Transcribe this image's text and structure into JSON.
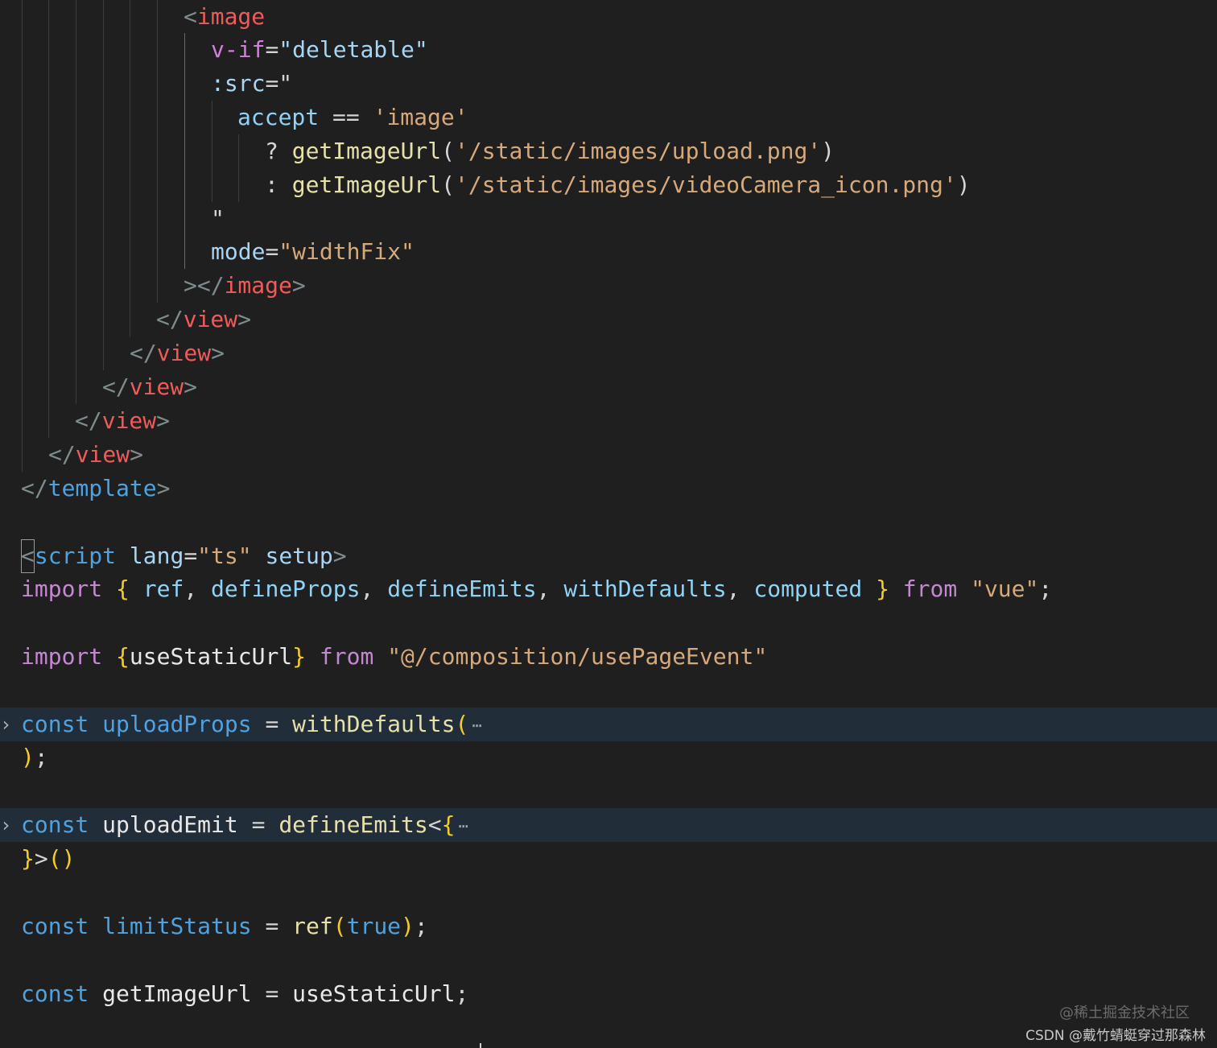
{
  "editor": {
    "lines": [
      {
        "tokens": [
          [
            "<",
            "punct"
          ],
          [
            "image",
            "tag"
          ]
        ]
      },
      {
        "tokens": [
          [
            "v-if",
            "attr-pink"
          ],
          [
            "=",
            "plain"
          ],
          [
            "\"deletable\"",
            "attr"
          ]
        ]
      },
      {
        "tokens": [
          [
            ":src",
            "attr"
          ],
          [
            "=\"",
            "plain"
          ]
        ]
      },
      {
        "tokens": [
          [
            "accept",
            "var"
          ],
          [
            " == ",
            "plain"
          ],
          [
            "'image'",
            "str"
          ]
        ]
      },
      {
        "tokens": [
          [
            "? ",
            "plain"
          ],
          [
            "getImageUrl",
            "fn"
          ],
          [
            "(",
            "plain"
          ],
          [
            "'/static/images/upload.png'",
            "str"
          ],
          [
            ")",
            "plain"
          ]
        ]
      },
      {
        "tokens": [
          [
            ": ",
            "plain"
          ],
          [
            "getImageUrl",
            "fn"
          ],
          [
            "(",
            "plain"
          ],
          [
            "'/static/images/videoCamera_icon.png'",
            "str"
          ],
          [
            ")",
            "plain"
          ]
        ]
      },
      {
        "tokens": [
          [
            "\"",
            "plain"
          ]
        ]
      },
      {
        "tokens": [
          [
            "mode",
            "attr"
          ],
          [
            "=",
            "plain"
          ],
          [
            "\"widthFix\"",
            "str"
          ]
        ]
      },
      {
        "tokens": [
          [
            "></",
            "punct"
          ],
          [
            "image",
            "tag"
          ],
          [
            ">",
            "punct"
          ]
        ]
      },
      {
        "tokens": [
          [
            "</",
            "punct"
          ],
          [
            "view",
            "tag"
          ],
          [
            ">",
            "punct"
          ]
        ]
      },
      {
        "tokens": [
          [
            "</",
            "punct"
          ],
          [
            "view",
            "tag"
          ],
          [
            ">",
            "punct"
          ]
        ]
      },
      {
        "tokens": [
          [
            "</",
            "punct"
          ],
          [
            "view",
            "tag"
          ],
          [
            ">",
            "punct"
          ]
        ]
      },
      {
        "tokens": [
          [
            "</",
            "punct"
          ],
          [
            "view",
            "tag"
          ],
          [
            ">",
            "punct"
          ]
        ]
      },
      {
        "tokens": [
          [
            "</",
            "punct"
          ],
          [
            "view",
            "tag"
          ],
          [
            ">",
            "punct"
          ]
        ]
      },
      {
        "tokens": [
          [
            "</",
            "punct"
          ],
          [
            "template",
            "tag-blue"
          ],
          [
            ">",
            "punct"
          ]
        ]
      },
      {
        "tokens": []
      },
      {
        "tokens": [
          [
            "<",
            "cursor"
          ],
          [
            "script",
            "tag-blue"
          ],
          [
            " ",
            "plain"
          ],
          [
            "lang",
            "attr"
          ],
          [
            "=",
            "plain"
          ],
          [
            "\"ts\"",
            "str"
          ],
          [
            " ",
            "plain"
          ],
          [
            "setup",
            "attr"
          ],
          [
            ">",
            "punct"
          ]
        ]
      },
      {
        "tokens": [
          [
            "import",
            "kw"
          ],
          [
            " ",
            "plain"
          ],
          [
            "{",
            "brace"
          ],
          [
            " ",
            "plain"
          ],
          [
            "ref",
            "var"
          ],
          [
            ", ",
            "plain"
          ],
          [
            "defineProps",
            "var"
          ],
          [
            ", ",
            "plain"
          ],
          [
            "defineEmits",
            "var"
          ],
          [
            ", ",
            "plain"
          ],
          [
            "withDefaults",
            "var"
          ],
          [
            ", ",
            "plain"
          ],
          [
            "computed",
            "var"
          ],
          [
            " ",
            "plain"
          ],
          [
            "}",
            "brace"
          ],
          [
            " ",
            "plain"
          ],
          [
            "from",
            "kw"
          ],
          [
            " ",
            "plain"
          ],
          [
            "\"vue\"",
            "str"
          ],
          [
            ";",
            "plain"
          ]
        ]
      },
      {
        "tokens": []
      },
      {
        "tokens": [
          [
            "import",
            "kw"
          ],
          [
            " ",
            "plain"
          ],
          [
            "{",
            "brace"
          ],
          [
            "useStaticUrl",
            "var2"
          ],
          [
            "}",
            "brace"
          ],
          [
            " ",
            "plain"
          ],
          [
            "from",
            "kw"
          ],
          [
            " ",
            "plain"
          ],
          [
            "\"@/composition/usePageEvent\"",
            "str"
          ]
        ]
      },
      {
        "tokens": []
      },
      {
        "tokens": [
          [
            "const",
            "const"
          ],
          [
            " ",
            "plain"
          ],
          [
            "uploadProps",
            "const"
          ],
          [
            " = ",
            "plain"
          ],
          [
            "withDefaults",
            "fn"
          ],
          [
            "(",
            "brace"
          ]
        ],
        "folded": true
      },
      {
        "tokens": [
          [
            ")",
            "brace"
          ],
          [
            ";",
            "plain"
          ]
        ]
      },
      {
        "tokens": []
      },
      {
        "tokens": [
          [
            "const",
            "const"
          ],
          [
            " ",
            "plain"
          ],
          [
            "uploadEmit",
            "var2"
          ],
          [
            " = ",
            "plain"
          ],
          [
            "defineEmits",
            "fn"
          ],
          [
            "<",
            "plain"
          ],
          [
            "{",
            "brace"
          ]
        ],
        "folded": true
      },
      {
        "tokens": [
          [
            "}",
            "brace"
          ],
          [
            ">",
            "plain"
          ],
          [
            "()",
            "brace"
          ]
        ]
      },
      {
        "tokens": []
      },
      {
        "tokens": [
          [
            "const",
            "const"
          ],
          [
            " ",
            "plain"
          ],
          [
            "limitStatus",
            "const"
          ],
          [
            " = ",
            "plain"
          ],
          [
            "ref",
            "fn"
          ],
          [
            "(",
            "brace"
          ],
          [
            "true",
            "bool"
          ],
          [
            ")",
            "brace"
          ],
          [
            ";",
            "plain"
          ]
        ]
      },
      {
        "tokens": []
      },
      {
        "tokens": [
          [
            "const",
            "const"
          ],
          [
            " ",
            "plain"
          ],
          [
            "getImageUrl",
            "var2"
          ],
          [
            " = ",
            "plain"
          ],
          [
            "useStaticUrl",
            "var2"
          ],
          [
            ";",
            "plain"
          ]
        ]
      }
    ],
    "fold_chevron_icon": "chevron-right-icon",
    "fold_ellipsis": "⋯"
  },
  "watermark": {
    "platform": "@稀土掘金技术社区",
    "author": "CSDN @戴竹蜻蜓穿过那森林"
  }
}
